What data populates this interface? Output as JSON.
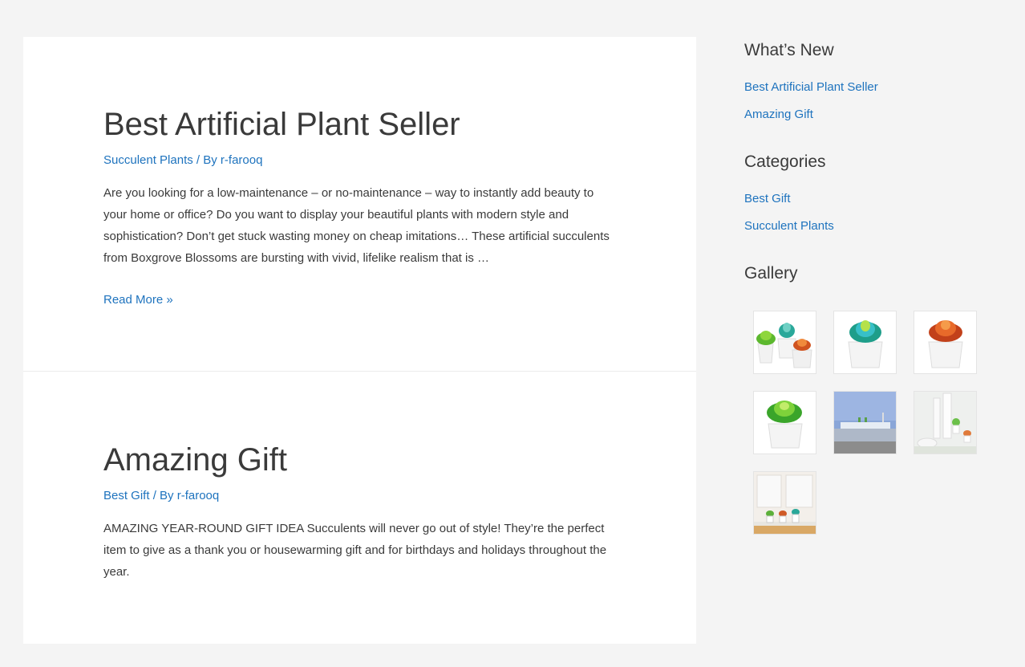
{
  "posts": [
    {
      "title": "Best Artificial Plant Seller",
      "category": "Succulent Plants",
      "by_label": " / By ",
      "author": "r-farooq",
      "excerpt": "Are you looking for a low-maintenance – or no-maintenance – way to instantly add beauty to your home or office? Do you want to display your beautiful plants with modern style and sophistication? Don’t get stuck wasting money on cheap imitations… These artificial succulents from Boxgrove Blossoms are bursting with vivid, lifelike realism that is …",
      "read_more": "Read More »"
    },
    {
      "title": "Amazing Gift",
      "category": "Best Gift",
      "by_label": " / By ",
      "author": "r-farooq",
      "excerpt": "AMAZING YEAR-ROUND GIFT IDEA Succulents will never go out of style! They’re the perfect item to give as a thank you or housewarming gift and for birthdays and holidays throughout the year."
    }
  ],
  "sidebar": {
    "whats_new": {
      "title": "What’s New",
      "items": [
        "Best Artificial Plant Seller",
        "Amazing Gift"
      ]
    },
    "categories": {
      "title": "Categories",
      "items": [
        "Best Gift",
        "Succulent Plants"
      ]
    },
    "gallery": {
      "title": "Gallery",
      "images": [
        "three-succulents-image",
        "blue-green-succulent-image",
        "orange-succulent-image",
        "green-succulent-image",
        "bathroom-scene-image",
        "white-bath-scene-image",
        "windowsill-scene-image"
      ]
    }
  },
  "colors": {
    "link": "#1e73be",
    "text": "#3a3a3a",
    "background": "#f4f4f4"
  }
}
